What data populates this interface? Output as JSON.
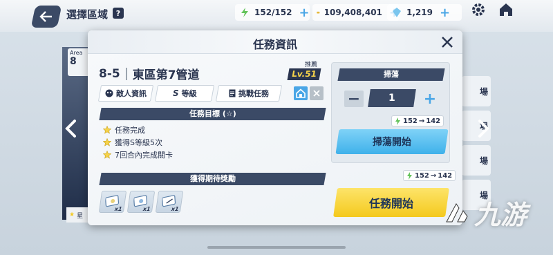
{
  "header": {
    "page_title": "選擇區域",
    "help_label": "?",
    "ap": "152/152",
    "credits": "109,408,401",
    "gems": "1,219",
    "plus": "+"
  },
  "background": {
    "area_label": "Area",
    "area_number": "8",
    "star_strip": "星",
    "right_label": "場"
  },
  "modal": {
    "title": "任務資訊",
    "stage_code": "8-5",
    "stage_name": "東區第7管道",
    "recommend_label": "推薦",
    "recommend_level": "Lv.51",
    "tabs": [
      {
        "label": "敵人資訊",
        "icon": "enemy-icon"
      },
      {
        "label": "等級",
        "prefix": "S",
        "icon": "s-rank-icon"
      },
      {
        "label": "挑戰任務",
        "icon": "document-icon"
      }
    ],
    "objectives_title": "任務目標 (☆)",
    "objectives": [
      "任務完成",
      "獲得S等級5次",
      "7回合內完成關卡"
    ],
    "rewards_title": "獲得期待獎勵",
    "rewards": [
      {
        "qty": "x1"
      },
      {
        "qty": "x1"
      },
      {
        "qty": "x1"
      }
    ],
    "sweep": {
      "title": "掃蕩",
      "minus": "−",
      "plus": "+",
      "count": "1",
      "cost_from": "152",
      "cost_arrow": "→",
      "cost_to": "142",
      "start_label": "掃蕩開始"
    },
    "mission_cost_from": "152",
    "mission_cost_arrow": "→",
    "mission_cost_to": "142",
    "mission_start_label": "任務開始"
  },
  "watermark": "九游",
  "colors": {
    "navy": "#3b4a66",
    "accent_blue": "#4aa6e6",
    "start_yellow": "#f4c91d",
    "level_gold": "#f6d34a"
  }
}
